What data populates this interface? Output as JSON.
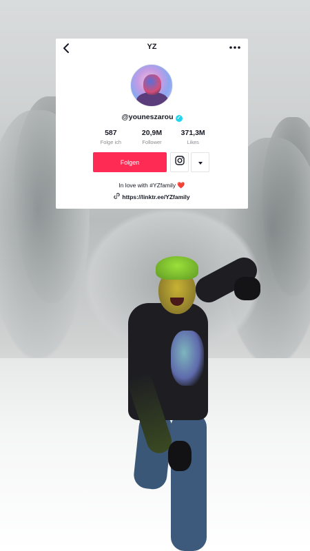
{
  "profile": {
    "title": "YZ",
    "handle": "@youneszarou",
    "verified": true,
    "stats": [
      {
        "value": "587",
        "label": "Folge ich"
      },
      {
        "value": "20,9M",
        "label": "Follower"
      },
      {
        "value": "371,3M",
        "label": "Likes"
      }
    ],
    "follow_label": "Folgen",
    "bio": "In love with #YZfamily",
    "bio_emoji": "❤️",
    "link": "https://linktr.ee/YZfamily"
  },
  "icons": {
    "back": "chevron-left-icon",
    "more": "more-dots-icon",
    "verified": "verified-check-icon",
    "instagram": "instagram-icon",
    "dropdown": "caret-down-icon",
    "link": "link-icon"
  },
  "colors": {
    "follow_button": "#fe2c55",
    "verified_badge": "#20d5ec",
    "text_primary": "#161823",
    "text_secondary": "#8a8b91"
  }
}
